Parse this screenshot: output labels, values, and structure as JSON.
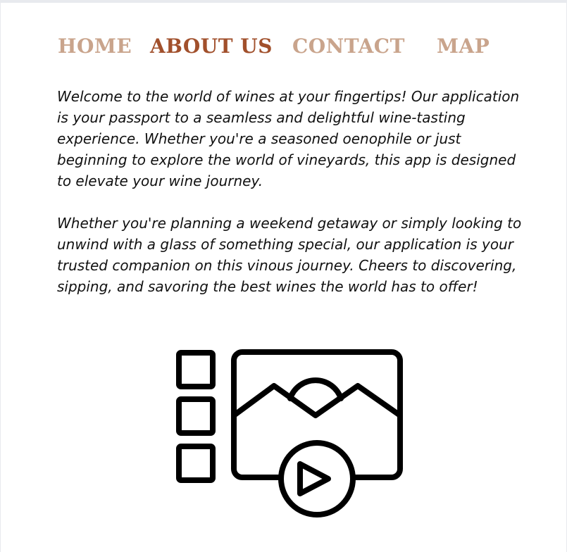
{
  "nav": {
    "items": [
      {
        "label": "HOME",
        "active": false
      },
      {
        "label": "ABOUT US",
        "active": true
      },
      {
        "label": "CONTACT",
        "active": false
      },
      {
        "label": "MAP",
        "active": false
      }
    ]
  },
  "colors": {
    "nav_inactive": "#c9a48c",
    "nav_active": "#a1502c",
    "text": "#111111",
    "background": "#ffffff"
  },
  "main": {
    "paragraphs": [
      "Welcome to the world of wines at your fingertips! Our application is your passport to a seamless and delightful wine-tasting experience. Whether you're a seasoned oenophile or just beginning to explore the world of vineyards, this app is designed to elevate your wine journey.",
      "Whether you're planning a weekend getaway or simply looking to unwind with a glass of something special, our application is your trusted companion on this vinous journey. Cheers to discovering, sipping, and savoring the best wines the world has to offer!"
    ],
    "media_icon": "video-gallery-icon"
  }
}
